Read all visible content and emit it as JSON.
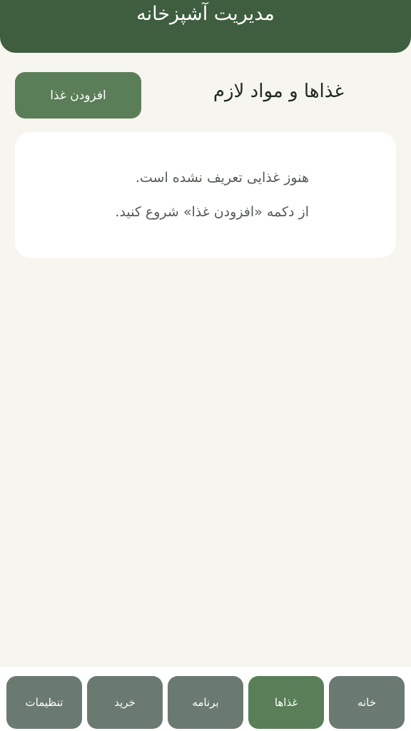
{
  "header": {
    "title": "مدیریت آشپزخانه"
  },
  "section": {
    "title": "غذاها و مواد لازم",
    "add_button_label": "افزودن غذا"
  },
  "empty_state": {
    "line1": "هنوز غذایی تعریف نشده است.",
    "line2": "از دکمه «افزودن غذا» شروع کنید."
  },
  "bottom_nav": {
    "active": "غذاها",
    "tabs": [
      {
        "label": "خانه"
      },
      {
        "label": "غذاها"
      },
      {
        "label": "برنامه"
      },
      {
        "label": "خرید"
      },
      {
        "label": "تنظیمات"
      }
    ]
  },
  "colors": {
    "header": "#3e5e3f",
    "accent": "#5a7e58",
    "tab_inactive": "#6b7a70",
    "background": "#f6f5ef"
  }
}
